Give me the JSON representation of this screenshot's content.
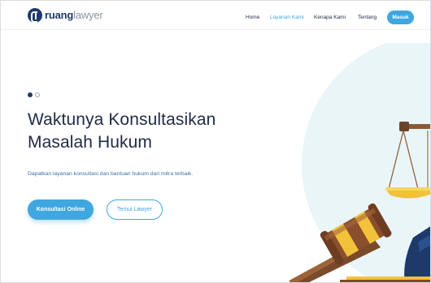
{
  "brand": {
    "name_bold": "ruang",
    "name_light": "lawyer",
    "color_primary": "#1e3a6b",
    "color_accent": "#3fa7e0"
  },
  "nav": {
    "home": "Home",
    "layanan": "Layanan Kami",
    "kenapa": "Kenapa Kami",
    "tentang": "Tentang",
    "masuk": "Masuk",
    "active_item": "Layanan Kami"
  },
  "hero": {
    "slide_count": 2,
    "active_slide": 1,
    "title_line1": "Waktunya Konsultasikan",
    "title_line2": "Masalah Hukum",
    "subtitle": "Dapatkan layanan konsultasi dan bantuan hukum dari mitra terbaik.",
    "btn_primary": "Konsultasi Online",
    "btn_secondary": "Temui Lawyer"
  },
  "illustration": {
    "icons": [
      "scales-of-justice-icon",
      "gavel-icon"
    ]
  }
}
